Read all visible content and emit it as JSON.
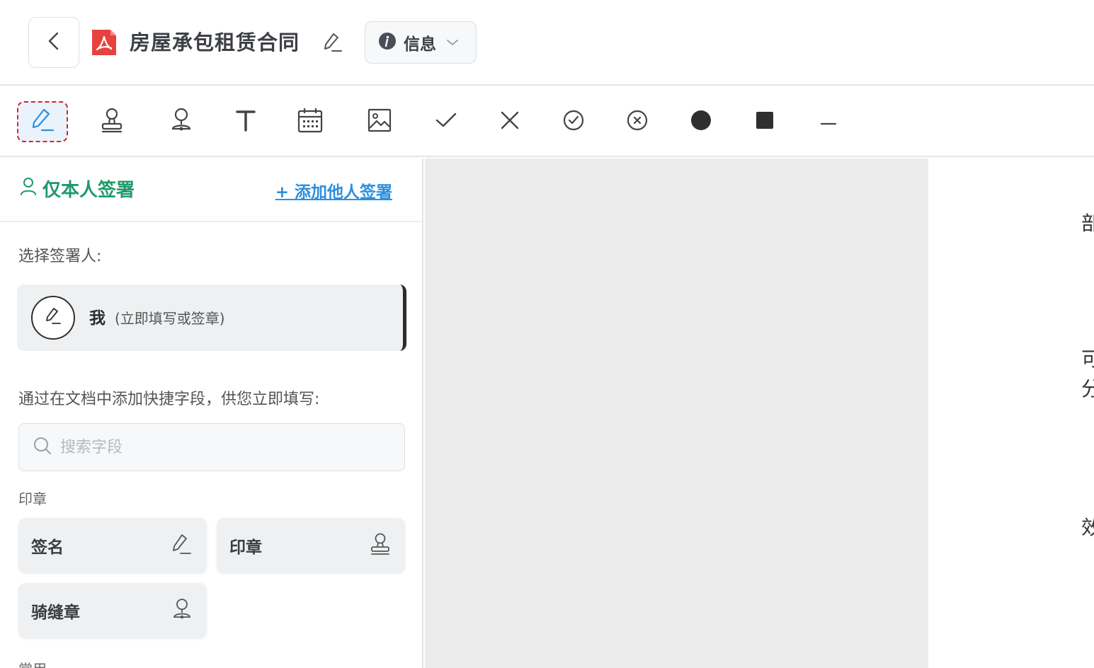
{
  "header": {
    "back_label": "",
    "doc_title": "房屋承包租赁合同",
    "info_label": "信息"
  },
  "toolbar": {
    "tools": [
      {
        "name": "signature",
        "icon": "pen-icon",
        "active": true
      },
      {
        "name": "seal",
        "icon": "stamp-icon"
      },
      {
        "name": "cross-page-seal",
        "icon": "cross-seal-icon"
      },
      {
        "name": "text",
        "icon": "text-icon"
      },
      {
        "name": "date",
        "icon": "calendar-icon"
      },
      {
        "name": "image",
        "icon": "image-icon"
      },
      {
        "name": "check",
        "icon": "check-icon"
      },
      {
        "name": "cross",
        "icon": "cross-icon"
      },
      {
        "name": "circle-check",
        "icon": "circle-check-icon"
      },
      {
        "name": "circle-cross",
        "icon": "circle-cross-icon"
      },
      {
        "name": "dot",
        "icon": "filled-circle-icon"
      },
      {
        "name": "square",
        "icon": "filled-square-icon"
      },
      {
        "name": "line",
        "icon": "line-icon"
      }
    ]
  },
  "panel": {
    "mode_label": "仅本人签署",
    "add_signer_label": "+ 添加他人签署",
    "choose_signer_label": "选择签署人:",
    "signer_name": "我",
    "signer_note": "(立即填写或签章)",
    "quick_fields_label": "通过在文档中添加快捷字段，供您立即填写:",
    "search_placeholder": "搜索字段",
    "group_seal": "印章",
    "fields": {
      "signature": "签名",
      "seal": "印章",
      "cross_seal": "骑缝章"
    },
    "group_common": "常用"
  },
  "document": {
    "visible_chars": [
      "部",
      "可",
      "分",
      "效"
    ]
  },
  "colors": {
    "accent_green": "#1f9a6b",
    "link_blue": "#2b8fe0",
    "active_dashed": "#d8232a",
    "pdf_red": "#e8423f"
  }
}
